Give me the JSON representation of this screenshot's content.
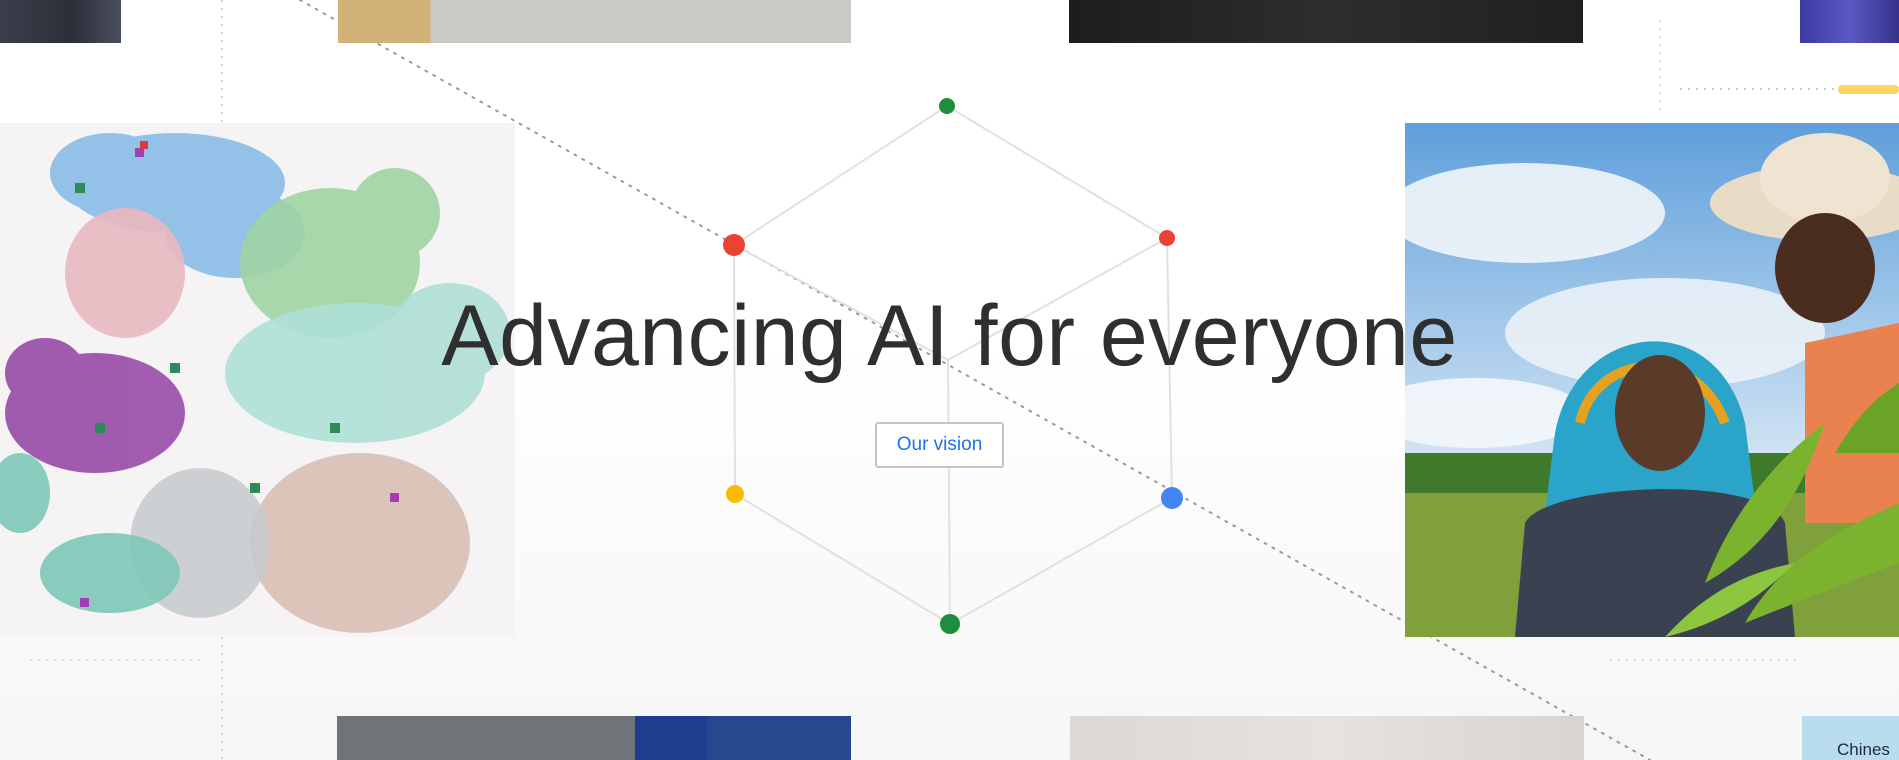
{
  "hero": {
    "title": "Advancing AI for everyone",
    "button_label": "Our vision"
  },
  "tiles": {
    "bottom_right_caption": "Chines"
  },
  "colors": {
    "title_text": "#2f2f2f",
    "button_text": "#1a73e8",
    "button_border": "#c4c4c4",
    "node_green": "#1e8e3e",
    "node_red": "#ea4335",
    "node_yellow": "#fbbc04",
    "node_blue": "#4285f4",
    "accent_yellow": "#fdd663"
  }
}
